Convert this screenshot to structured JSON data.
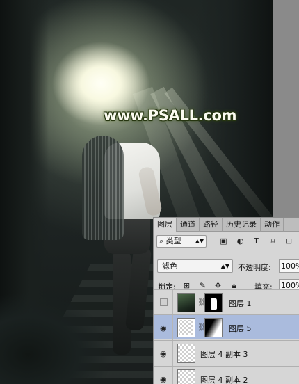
{
  "watermark": "www.PSALL.com",
  "panel": {
    "tabs": [
      "图层",
      "通道",
      "路径",
      "历史记录",
      "动作"
    ],
    "active_tab": "图层",
    "filter": {
      "kind_label": "类型",
      "icons": [
        "search-icon",
        "image-filter-icon",
        "adjustment-filter-icon",
        "text-filter-icon",
        "shape-filter-icon",
        "smart-object-filter-icon"
      ]
    },
    "blend_mode": "滤色",
    "opacity_label": "不透明度:",
    "opacity_value": "100%",
    "lock_label": "锁定:",
    "lock_icons": [
      "lock-transparent-icon",
      "lock-paint-icon",
      "lock-position-icon",
      "lock-all-icon"
    ],
    "fill_label": "填充:",
    "fill_value": "100%",
    "layers": [
      {
        "name": "图层 1",
        "visible": false,
        "selected": false
      },
      {
        "name": "图层 5",
        "visible": true,
        "selected": true
      },
      {
        "name": "图层 4 副本 3",
        "visible": true,
        "selected": false
      },
      {
        "name": "图层 4 副本 2",
        "visible": true,
        "selected": false
      }
    ]
  }
}
